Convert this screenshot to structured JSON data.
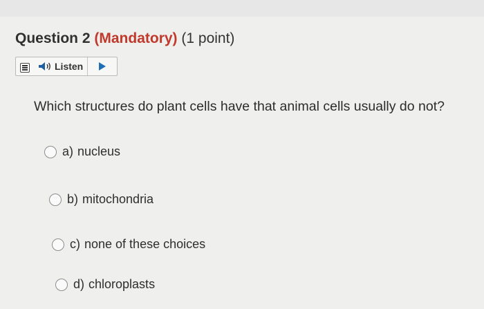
{
  "question": {
    "number_label": "Question 2",
    "mandatory_label": "(Mandatory)",
    "points_label": "(1 point)",
    "text": "Which structures do plant cells have that animal cells usually do not?"
  },
  "listen": {
    "label": "Listen",
    "menu_icon": "menu-icon",
    "speaker_icon": "speaker-icon",
    "play_icon": "play-icon",
    "accent_color": "#1f6fb5"
  },
  "options": [
    {
      "letter": "a)",
      "text": "nucleus"
    },
    {
      "letter": "b)",
      "text": "mitochondria"
    },
    {
      "letter": "c)",
      "text": "none of these choices"
    },
    {
      "letter": "d)",
      "text": "chloroplasts"
    }
  ],
  "colors": {
    "mandatory": "#c0392b",
    "background": "#efefee"
  }
}
